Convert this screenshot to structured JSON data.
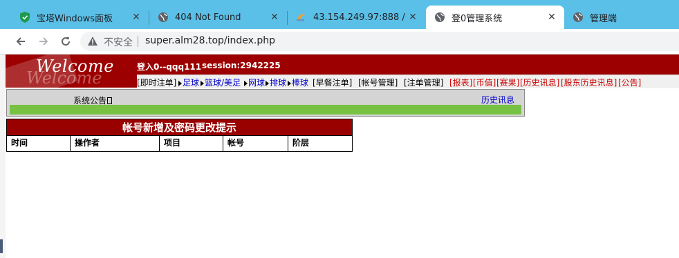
{
  "browser": {
    "tabs": [
      {
        "title": "宝塔Windows面板",
        "icon": "bt-shield-icon"
      },
      {
        "title": "404 Not Found",
        "icon": "globe-icon"
      },
      {
        "title": "43.154.249.97:888 / loca",
        "icon": "phpmyadmin-icon"
      },
      {
        "title": "登0管理系统",
        "icon": "globe-icon",
        "active": true
      },
      {
        "title": "管理端",
        "icon": "globe-icon"
      }
    ],
    "close_glyph": "✕",
    "insecure_label": "不安全",
    "url": "super.alm28.top/index.php"
  },
  "page": {
    "logo": {
      "text": "Welcome"
    },
    "login_text": "登入0--qqq111",
    "session_text": "session:2942225",
    "menu": [
      {
        "label": "[即时注单]",
        "color": "black"
      },
      {
        "label": "足球",
        "color": "blue",
        "arrow": true
      },
      {
        "label": "篮球/美足",
        "color": "blue",
        "arrow": true
      },
      {
        "label": "网球",
        "color": "blue",
        "arrow": true
      },
      {
        "label": "排球",
        "color": "blue",
        "arrow": true
      },
      {
        "label": "棒球",
        "color": "blue",
        "arrow": true
      },
      {
        "label": "[早餐注单]",
        "color": "black"
      },
      {
        "label": "[帐号管理]",
        "color": "black"
      },
      {
        "label": "[注单管理]",
        "color": "black"
      },
      {
        "label": "[报表]",
        "color": "red"
      },
      {
        "label": "[币值]",
        "color": "red"
      },
      {
        "label": "[赛果]",
        "color": "red"
      },
      {
        "label": "[历史讯息]",
        "color": "red"
      },
      {
        "label": "[股东历史讯息]",
        "color": "red"
      },
      {
        "label": "[公告]",
        "color": "red"
      }
    ],
    "notice": {
      "label": "系统公告",
      "history_link": "历史讯息"
    },
    "table": {
      "title": "帐号新增及密码更改提示",
      "columns": [
        "时间",
        "操作者",
        "项目",
        "帐号",
        "阶层"
      ]
    }
  },
  "colors": {
    "tabstrip": "#5bc0e8",
    "header_red": "#9c0000",
    "progress_green": "#77c242",
    "link_blue": "#0000cc",
    "menu_red": "#cc0000"
  }
}
